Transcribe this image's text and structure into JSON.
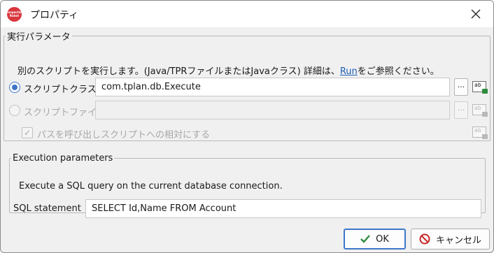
{
  "window": {
    "title": "プロパティ",
    "logo_text": "Inspection Robot"
  },
  "exec_group": {
    "legend": "実行パラメータ",
    "desc_prefix": "別のスクリプトを実行します。(Java/TPRファイルまたはJavaクラス) 詳細は、",
    "desc_link": "Run",
    "desc_suffix": "をご参照ください。",
    "script_class": {
      "label": "スクリプトクラス",
      "value": "com.tplan.db.Execute",
      "selected": true,
      "browse_label": "..."
    },
    "script_file": {
      "label": "スクリプトファイル",
      "value": "",
      "selected": false,
      "enabled": false,
      "browse_label": "..."
    },
    "relative_path": {
      "label": "パスを呼び出しスクリプトへの相対にする",
      "checked": true,
      "enabled": false
    },
    "bind_icon_text": "ab"
  },
  "params_group": {
    "legend": "Execution parameters",
    "desc": "Execute a SQL query on the current database connection.",
    "sql_label": "SQL statement",
    "sql_value": "SELECT Id,Name FROM Account"
  },
  "buttons": {
    "ok": "OK",
    "cancel": "キャンセル"
  },
  "colors": {
    "accent": "#3d76c9",
    "link": "#1f5fb5",
    "ok_check": "#2e8b3e",
    "cancel_icon": "#c62828"
  },
  "icons": {
    "close": "close-icon",
    "ok": "check-icon",
    "cancel": "prohibit-icon"
  }
}
